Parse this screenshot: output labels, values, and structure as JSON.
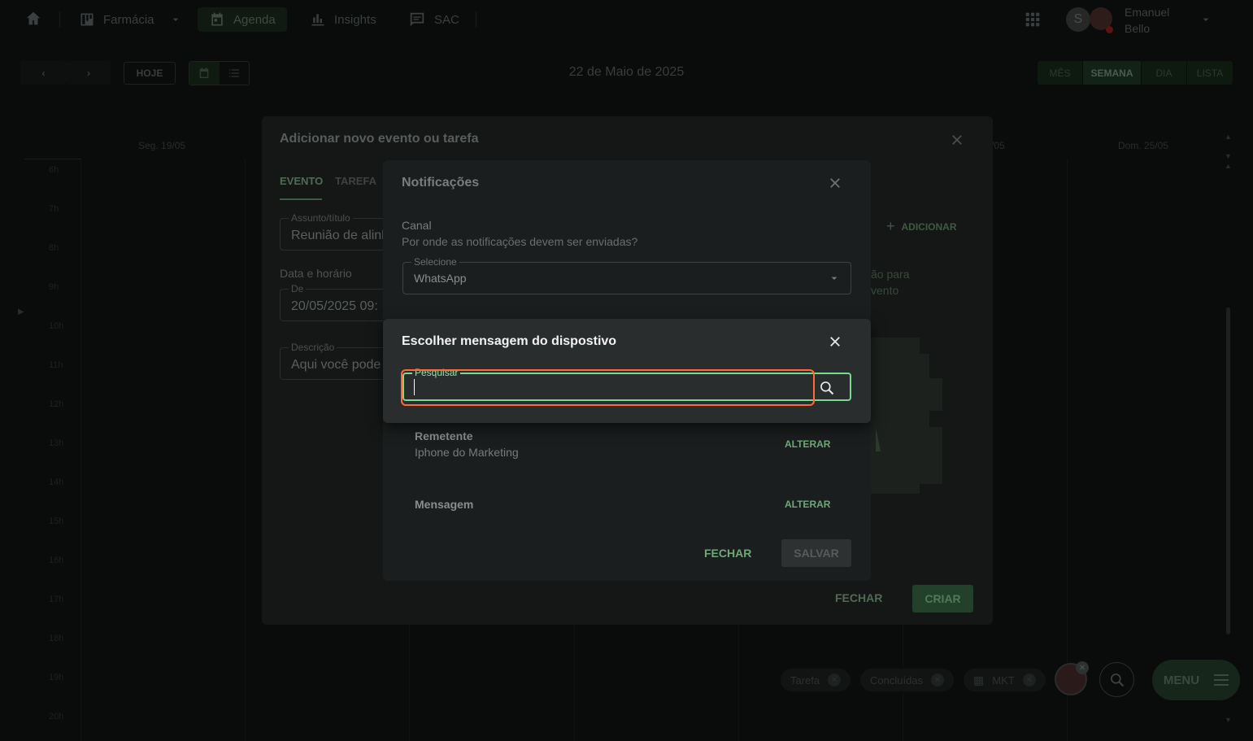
{
  "topbar": {
    "pharmacy_label": "Farmácia",
    "agenda_label": "Agenda",
    "insights_label": "Insights",
    "sac_label": "SAC",
    "avatar_initial": "S",
    "user_first": "Emanuel",
    "user_last": "Bello"
  },
  "toolbar": {
    "today_label": "HOJE",
    "current_date": "22 de Maio de 2025",
    "views": [
      "MÊS",
      "SEMANA",
      "DIA",
      "LISTA"
    ],
    "active_view": "SEMANA"
  },
  "calendar": {
    "day_left": "Seg. 19/05",
    "day_mid": "/05",
    "day_right": "Dom. 25/05",
    "hours": [
      "6h",
      "7h",
      "8h",
      "9h",
      "10h",
      "11h",
      "12h",
      "13h",
      "14h",
      "15h",
      "16h",
      "17h",
      "18h",
      "19h",
      "20h"
    ]
  },
  "event_dialog": {
    "title": "Adicionar novo evento ou tarefa",
    "tabs": [
      "EVENTO",
      "TAREFA"
    ],
    "subject_label": "Assunto/título",
    "subject_value": "Reunião de alinh",
    "datetime_label": "Data e horário",
    "from_label": "De",
    "from_value": "20/05/2025 09:",
    "description_label": "Descrição",
    "description_value": "Aqui você pode",
    "add_label": "ADICIONAR",
    "side_text_1": "ão para",
    "side_text_2": "vento",
    "close_label": "FECHAR",
    "create_label": "CRIAR"
  },
  "notifications_dialog": {
    "title": "Notificações",
    "channel_label": "Canal",
    "channel_help": "Por onde as notificações devem ser enviadas?",
    "select_label": "Selecione",
    "select_value": "WhatsApp",
    "sender_label": "Remetente",
    "sender_value": "Iphone do Marketing",
    "message_label": "Mensagem",
    "change_label": "ALTERAR",
    "close_label": "FECHAR",
    "save_label": "SALVAR"
  },
  "message_dialog": {
    "title": "Escolher mensagem do dispostivo",
    "search_label": "Pesquisar",
    "search_value": ""
  },
  "bottom_bar": {
    "chips": [
      "Tarefa",
      "Concluídas",
      "MKT"
    ],
    "menu_label": "MENU"
  },
  "colors": {
    "accent": "#7bd88f",
    "highlight": "#ff6a3d",
    "dialog_bg": "#2a2d2d"
  }
}
